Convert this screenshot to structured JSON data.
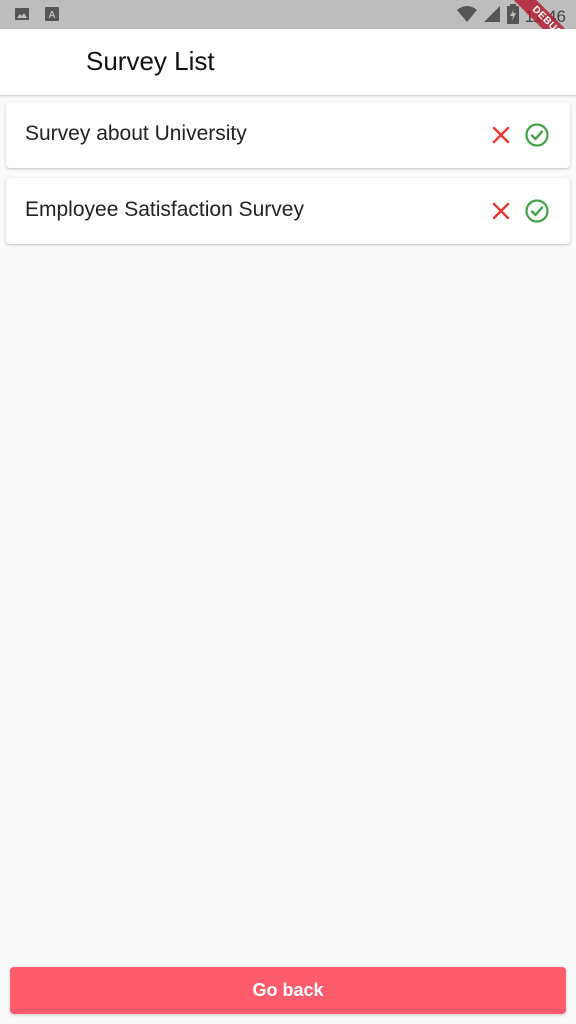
{
  "status_bar": {
    "time": "11:46",
    "left_icons": [
      "image-icon",
      "font-a-icon"
    ],
    "right_icons": [
      "wifi-icon",
      "signal-icon",
      "battery-icon"
    ]
  },
  "debug_banner": {
    "label": "DEBUG"
  },
  "app_bar": {
    "title": "Survey List"
  },
  "surveys": [
    {
      "title": "Survey about University",
      "actions": [
        "close-icon",
        "check-circle-icon"
      ]
    },
    {
      "title": "Employee Satisfaction Survey",
      "actions": [
        "close-icon",
        "check-circle-icon"
      ]
    }
  ],
  "colors": {
    "reject": "#e53935",
    "accept": "#43a047",
    "primary_button": "#fc5c6c",
    "status_bar": "#bdbdbd"
  },
  "footer": {
    "go_back_label": "Go back"
  }
}
